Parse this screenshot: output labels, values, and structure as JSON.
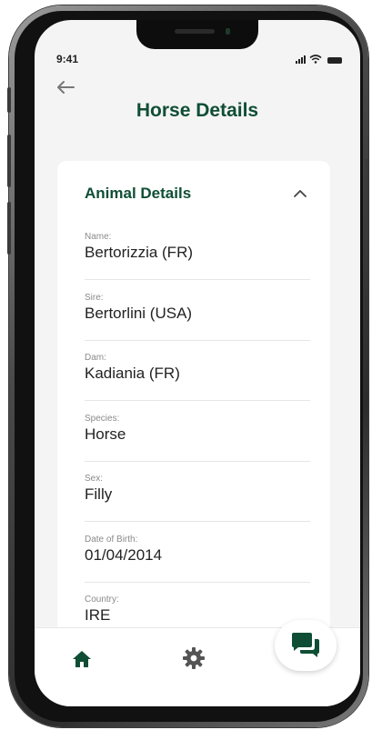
{
  "status_bar": {
    "time": "9:41"
  },
  "header": {
    "title": "Horse Details"
  },
  "card": {
    "title": "Animal Details",
    "fields": [
      {
        "label": "Name:",
        "value": "Bertorizzia (FR)"
      },
      {
        "label": "Sire:",
        "value": "Bertorlini (USA)"
      },
      {
        "label": "Dam:",
        "value": "Kadiania (FR)"
      },
      {
        "label": "Species:",
        "value": "Horse"
      },
      {
        "label": "Sex:",
        "value": "Filly"
      },
      {
        "label": "Date of Birth:",
        "value": "01/04/2014"
      },
      {
        "label": "Country:",
        "value": "IRE"
      }
    ]
  },
  "colors": {
    "brand": "#0f4e35",
    "background": "#f4f4f4"
  },
  "icons": {
    "back": "arrow-left-icon",
    "collapse": "chevron-up-icon",
    "home": "home-icon",
    "settings": "gear-icon",
    "chat": "chat-bubbles-icon"
  }
}
